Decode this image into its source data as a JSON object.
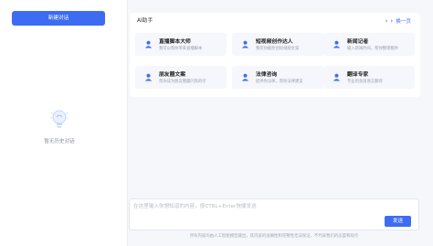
{
  "sidebar": {
    "new_chat_label": "新建对话",
    "empty_text": "暂无历史对话"
  },
  "assistant_panel": {
    "title": "AI助手",
    "next_page_label": "换一页",
    "cards": [
      {
        "title": "直播脚本大师",
        "desc": "我可以帮你带来直播脚本"
      },
      {
        "title": "短视频创作达人",
        "desc": "我可你能原创短视频文案"
      },
      {
        "title": "新闻记者",
        "desc": "输入新闻时间，帮你整理稿件"
      },
      {
        "title": "朋友圈文案",
        "desc": "帮你成为朋友圈最闪亮的仔"
      },
      {
        "title": "法律咨询",
        "desc": "提供你法律，帮你法律建议"
      },
      {
        "title": "翻译专家",
        "desc": "专业的多国语言翻译"
      }
    ]
  },
  "composer": {
    "placeholder": "在这里输入你想知道的内容，按CTRL+Enter快捷发送",
    "send_label": "发送"
  },
  "footer": {
    "disclaimer": "所有内容均由人工智能模型输出，其内容的准确性和完整性无法保证，不代表我们的态度和观点"
  },
  "colors": {
    "accent": "#3d6cf2",
    "background": "#f5f7fb"
  }
}
